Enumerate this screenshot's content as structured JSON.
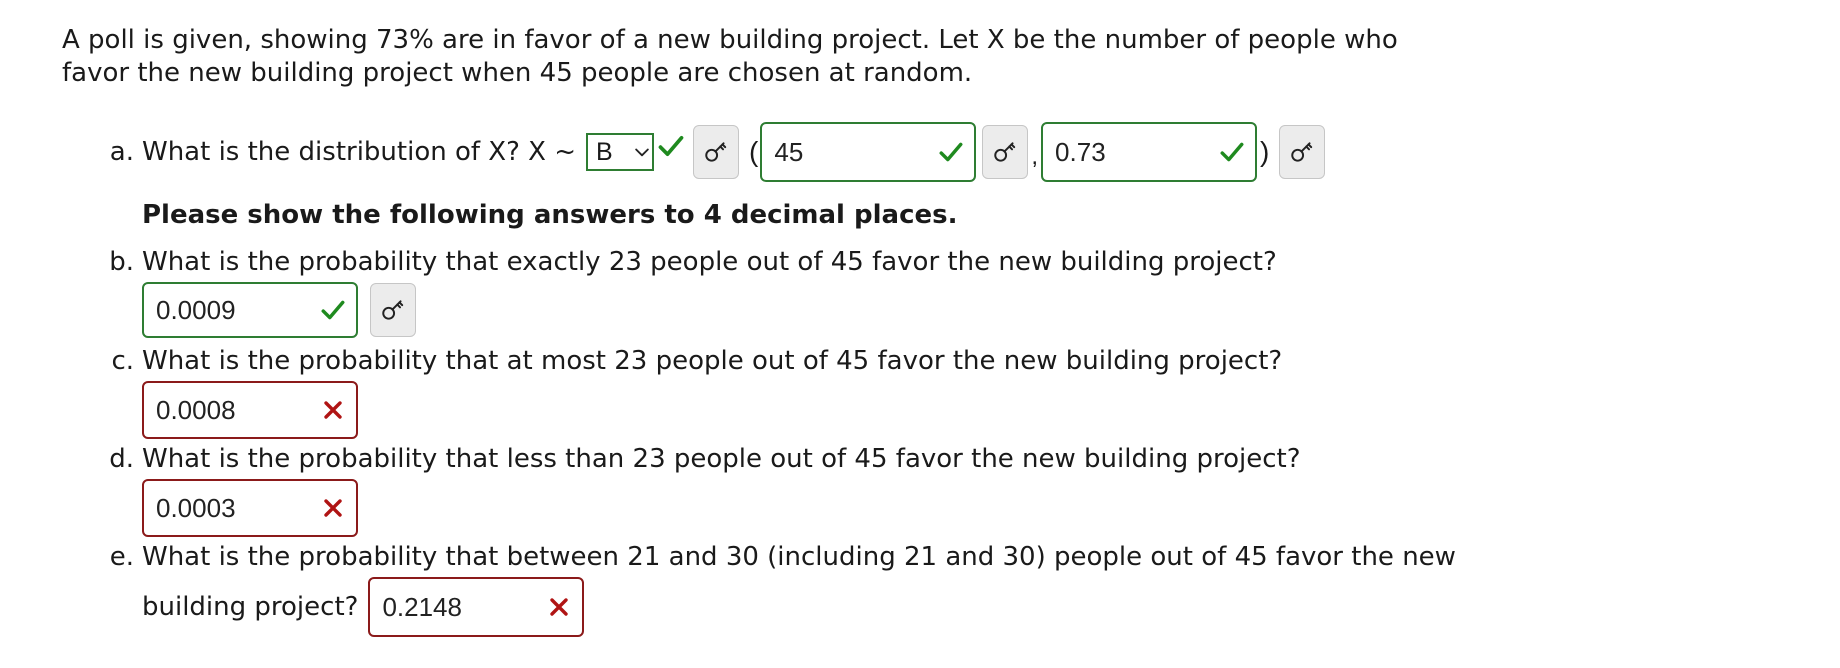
{
  "intro": "A poll is given, showing 73% are in favor of a new building project. Let X be the number of people who favor the new building project when 45 people are chosen at random.",
  "part_a": {
    "letter": "a.",
    "question": "What is the distribution of X? X ~",
    "dist_select_value": "B",
    "open_paren": "(",
    "n_value": "45",
    "comma": ",",
    "p_value": "0.73",
    "close_paren": ")"
  },
  "note": "Please show the following answers to 4 decimal places.",
  "part_b": {
    "letter": "b.",
    "question": "What is the probability that exactly 23 people out of 45 favor the new building project?",
    "answer": "0.0009",
    "status": "correct"
  },
  "part_c": {
    "letter": "c.",
    "question": "What is the probability that at most 23 people out of 45 favor the new building project?",
    "answer": "0.0008",
    "status": "incorrect"
  },
  "part_d": {
    "letter": "d.",
    "question": "What is the probability that less than 23 people out of 45 favor the new building project?",
    "answer": "0.0003",
    "status": "incorrect"
  },
  "part_e": {
    "letter": "e.",
    "question_line1": "What is the probability that between 21 and 30 (including 21 and 30) people out of 45 favor the new",
    "question_line2": "building project?",
    "answer": "0.2148",
    "status": "incorrect"
  },
  "icons": {
    "correct": "check-icon",
    "incorrect": "x-icon",
    "key": "key-icon",
    "dropdown": "chevron-down-icon"
  },
  "colors": {
    "correct": "#2e7d32",
    "incorrect": "#8b1a1a",
    "correct_check": "#1f8a1f",
    "incorrect_x": "#b01414"
  }
}
